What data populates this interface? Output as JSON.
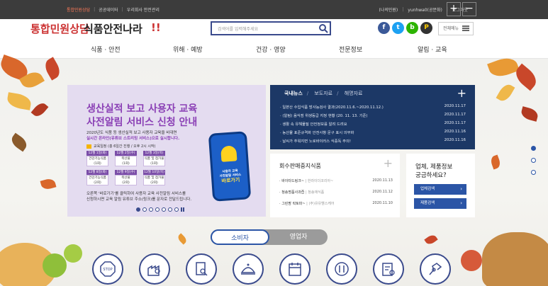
{
  "topbar": {
    "left_links": [
      "통합민원상담",
      "공공데이터",
      "우리회사 안전관리"
    ],
    "right_links": [
      "(나의민원)",
      "yunhwa0(공문화)",
      "로그아웃"
    ],
    "zoom_in": "+",
    "zoom_out": "−"
  },
  "header": {
    "logo_overlay": "통합민원상담",
    "logo_main": "식품안전나라",
    "logo_suffix": "!!",
    "search_placeholder": "검색어를 입력해주세요",
    "full_menu_label": "전체메뉴"
  },
  "gnb": [
    "식품 · 안전",
    "위해 · 예방",
    "건강 · 영양",
    "전문정보",
    "알림 · 교육"
  ],
  "banner": {
    "title_line1": "생산실적 보고 사용자 교육",
    "title_line2": "사전알림 서비스 신청 안내",
    "desc_line1": "2020년도 식품 등 생산실적 보고 사용자 교육을 비대면",
    "desc_line2": "실시간 온라인(유튜브 스트리밍 서비스)으로 실시합니다.",
    "tag": "교육일정 (총 6일간 진행 / 오후 2시 시작)",
    "schedule_headers": [
      "12월 1일(화)",
      "12월 2일(수)",
      "12월 3일(목)",
      "12월 8일(화)",
      "12월 9일(수)",
      "12월 10일(목)"
    ],
    "schedule_cells": [
      "건강기능식품\n(1회)",
      "축산물\n(1회)",
      "식품 및 첨가물\n(1회)",
      "건강기능식품\n(2회)",
      "축산물\n(2회)",
      "식품 및 첨가물\n(2회)"
    ],
    "notice_line1": "오른쪽 '바로가기'를 클릭하여 사용자 교육 사전알림 서비스를",
    "notice_line2": "신청하시면 교육 알림 유튜브 주소(링크)를 문자로 전달드립니다.",
    "phone_text1": "사용자 교육",
    "phone_text2": "사전알림 서비스",
    "phone_cta": "바로가기"
  },
  "news": {
    "tabs": [
      "국내뉴스",
      "보도자료",
      "해명자료"
    ],
    "items": [
      {
        "title": "일본산 수입식품 방사능검사 결과(2020.11.6.~2020.11.12.)",
        "date": "2020.11.17"
      },
      {
        "title": "(알림) 음식점 위생등급 지정 현황 (20. 11. 13. 기준)",
        "date": "2020.11.17"
      },
      {
        "title": "생활 속 유해물질 안전정보를 알려 드려요",
        "date": "2020.11.17"
      },
      {
        "title": "농산물 표준규격화 안전사항 문구 표시 의무화",
        "date": "2020.11.16"
      },
      {
        "title": "날씨가 추워지면 노로바이러스 식중독 주의!",
        "date": "2020.11.16"
      }
    ]
  },
  "recall": {
    "title": "회수판매중지식품",
    "items": [
      {
        "product": "바이타드링크~",
        "maker": "한라이더코리아~",
        "date": "2020.11.13"
      },
      {
        "product": "청송명품사과즙",
        "maker": "청송애식품",
        "date": "2020.11.12"
      },
      {
        "product": "그린팜 락토파~",
        "maker": "(주)유유헬스케어",
        "date": "2020.11.10"
      }
    ]
  },
  "company": {
    "question_line1": "업체, 제품정보",
    "question_line2": "궁금하세요?",
    "btn_company": "업체검색",
    "btn_product": "제품검색"
  },
  "audience_tabs": [
    "소비자",
    "영업자"
  ],
  "quick_icons": [
    "stop-icon",
    "factory-search-icon",
    "product-search-icon",
    "dish-icon",
    "calendar-icon",
    "restaurant-icon",
    "document-search-icon",
    "lab-icon"
  ],
  "colors": {
    "brand_navy": "#1c3866",
    "accent_blue": "#2b55a6",
    "banner_purple": "#8a3fb5"
  }
}
